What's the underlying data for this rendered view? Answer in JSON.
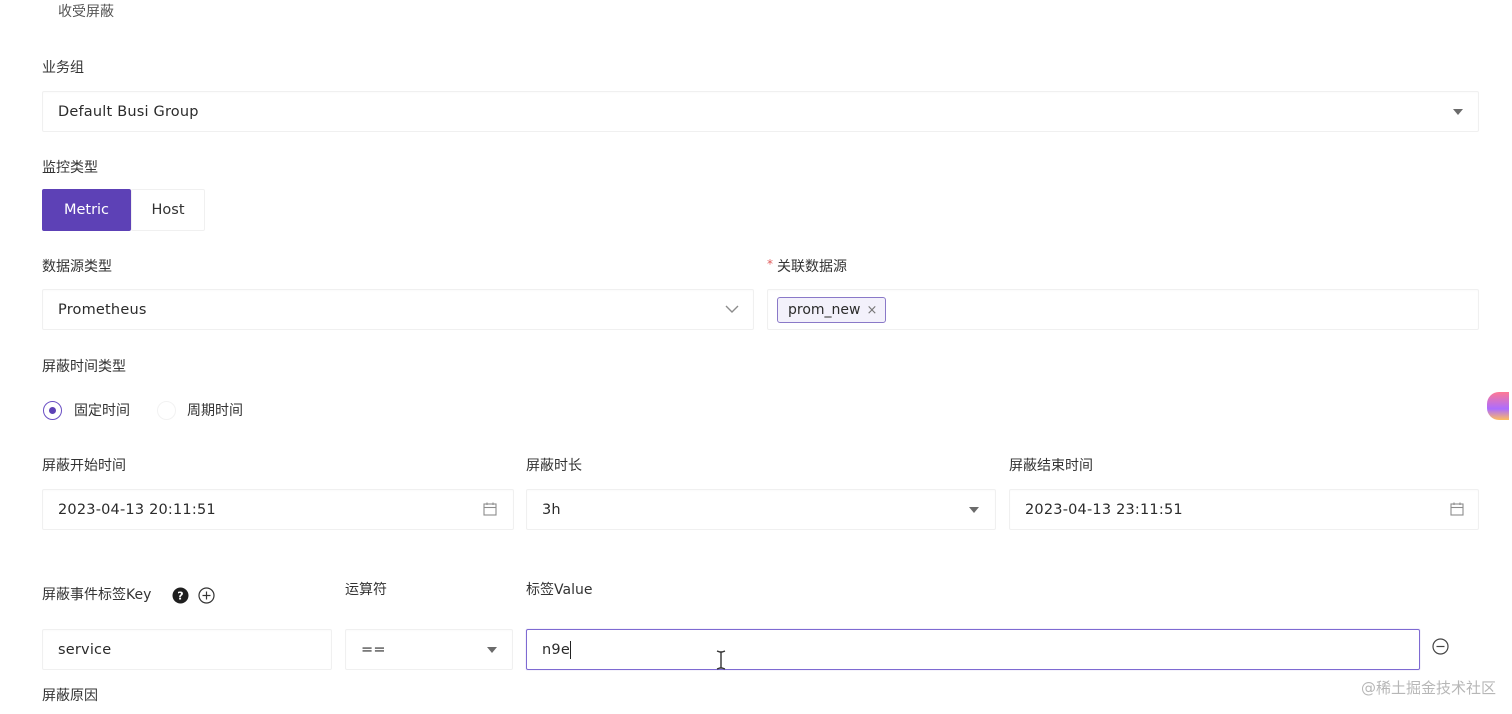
{
  "top_cut_label": "收受屏蔽",
  "business_group": {
    "label": "业务组",
    "value": "Default Busi Group"
  },
  "monitor_type": {
    "label": "监控类型",
    "options": [
      "Metric",
      "Host"
    ],
    "selected": "Metric"
  },
  "datasource_type": {
    "label": "数据源类型",
    "value": "Prometheus"
  },
  "linked_datasource": {
    "label": "关联数据源",
    "required_mark": "*",
    "tags": [
      "prom_new"
    ],
    "tag_close": "×"
  },
  "mute_time_type": {
    "label": "屏蔽时间类型",
    "options": [
      "固定时间",
      "周期时间"
    ],
    "selected": "固定时间"
  },
  "mute_start": {
    "label": "屏蔽开始时间",
    "value": "2023-04-13 20:11:51"
  },
  "mute_duration": {
    "label": "屏蔽时长",
    "value": "3h"
  },
  "mute_end": {
    "label": "屏蔽结束时间",
    "value": "2023-04-13 23:11:51"
  },
  "tag_filter": {
    "key_label": "屏蔽事件标签Key",
    "operator_label": "运算符",
    "value_label": "标签Value",
    "help_glyph": "?",
    "add_glyph": "+",
    "remove_glyph": "−",
    "row": {
      "key": "service",
      "operator": "==",
      "value": "n9e"
    }
  },
  "mute_reason": {
    "label": "屏蔽原因"
  },
  "watermark": "@稀土掘金技术社区",
  "colors": {
    "primary": "#5d41b6",
    "border": "#f0f0f0",
    "focus_border": "#7e6ad2",
    "required": "#e05a5a"
  }
}
